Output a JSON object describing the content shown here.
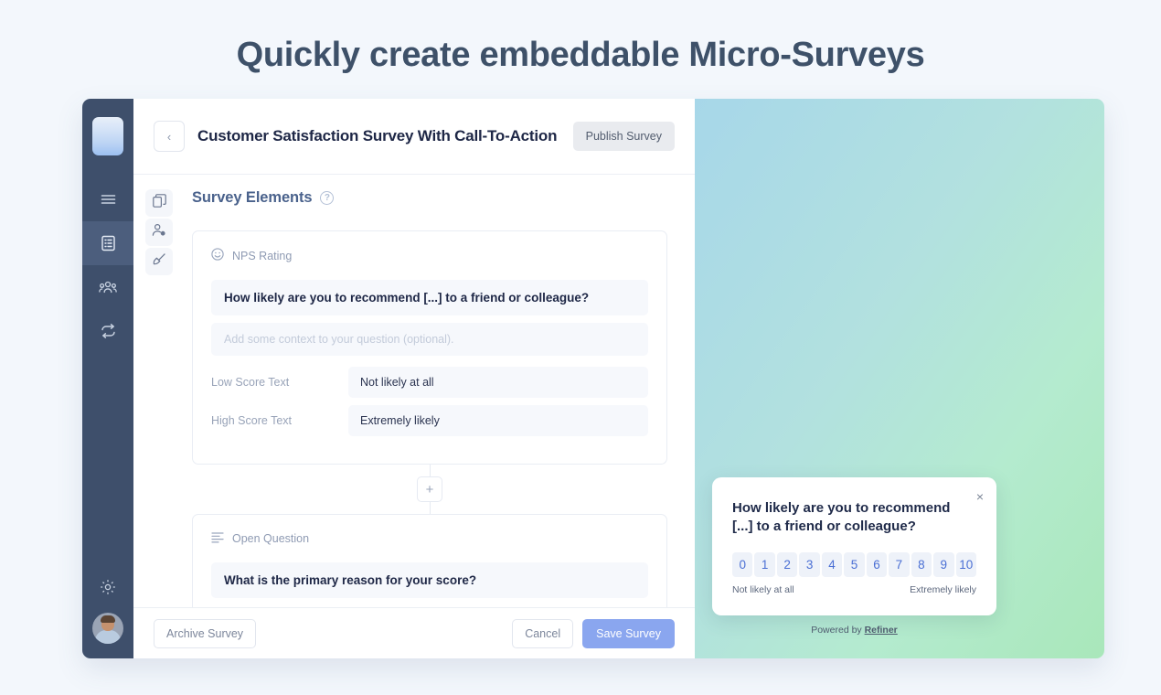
{
  "hero": {
    "title": "Quickly create embeddable Micro-Surveys"
  },
  "colors": {
    "page_background": "#f3f7fc",
    "sidebar": "#3e4f6b",
    "primary_button": "#8aa6ef",
    "heading_blue": "#4a628c",
    "score_text": "#4a6fd4",
    "preview_gradient_start": "#a7d7e9",
    "preview_gradient_end": "#a9e7ba"
  },
  "sidebar": {
    "logo_name": "app-logo",
    "items": [
      {
        "icon": "hamburger-menu-icon",
        "name": "menu",
        "active": false
      },
      {
        "icon": "surveys-list-icon",
        "name": "surveys",
        "active": true
      },
      {
        "icon": "people-icon",
        "name": "contacts",
        "active": false
      },
      {
        "icon": "loop-refresh-icon",
        "name": "integrations",
        "active": false
      }
    ],
    "settings_icon": "gear-icon",
    "avatar_name": "user-avatar"
  },
  "topbar": {
    "back_icon": "chevron-left-icon",
    "survey_title": "Customer Satisfaction Survey With Call-To-Action",
    "publish_label": "Publish Survey"
  },
  "tool_rail": {
    "items": [
      {
        "icon": "copy-layers-icon",
        "name": "duplicate-elements"
      },
      {
        "icon": "user-settings-icon",
        "name": "targeting"
      },
      {
        "icon": "paintbrush-icon",
        "name": "appearance"
      }
    ]
  },
  "section": {
    "title": "Survey Elements",
    "help_icon": "question-mark-icon",
    "help_glyph": "?"
  },
  "elements": [
    {
      "type_icon": "smiley-icon",
      "type_label": "NPS Rating",
      "question": "How likely are you to recommend [...] to a friend or colleague?",
      "description_placeholder": "Add some context to your question (optional).",
      "fields": [
        {
          "label": "Low Score Text",
          "value": "Not likely at all"
        },
        {
          "label": "High Score Text",
          "value": "Extremely likely"
        }
      ]
    },
    {
      "type_icon": "align-left-icon",
      "type_label": "Open Question",
      "question": "What is the primary reason for your score?"
    }
  ],
  "add_element": {
    "icon": "plus-icon",
    "glyph": "+"
  },
  "footer": {
    "archive_label": "Archive Survey",
    "cancel_label": "Cancel",
    "save_label": "Save Survey"
  },
  "preview_widget": {
    "close_icon": "close-icon",
    "close_glyph": "×",
    "question": "How likely are you to recommend [...] to a friend or colleague?",
    "scores": [
      "0",
      "1",
      "2",
      "3",
      "4",
      "5",
      "6",
      "7",
      "8",
      "9",
      "10"
    ],
    "low_label": "Not likely at all",
    "high_label": "Extremely likely",
    "powered_prefix": "Powered by ",
    "powered_brand": "Refiner"
  }
}
